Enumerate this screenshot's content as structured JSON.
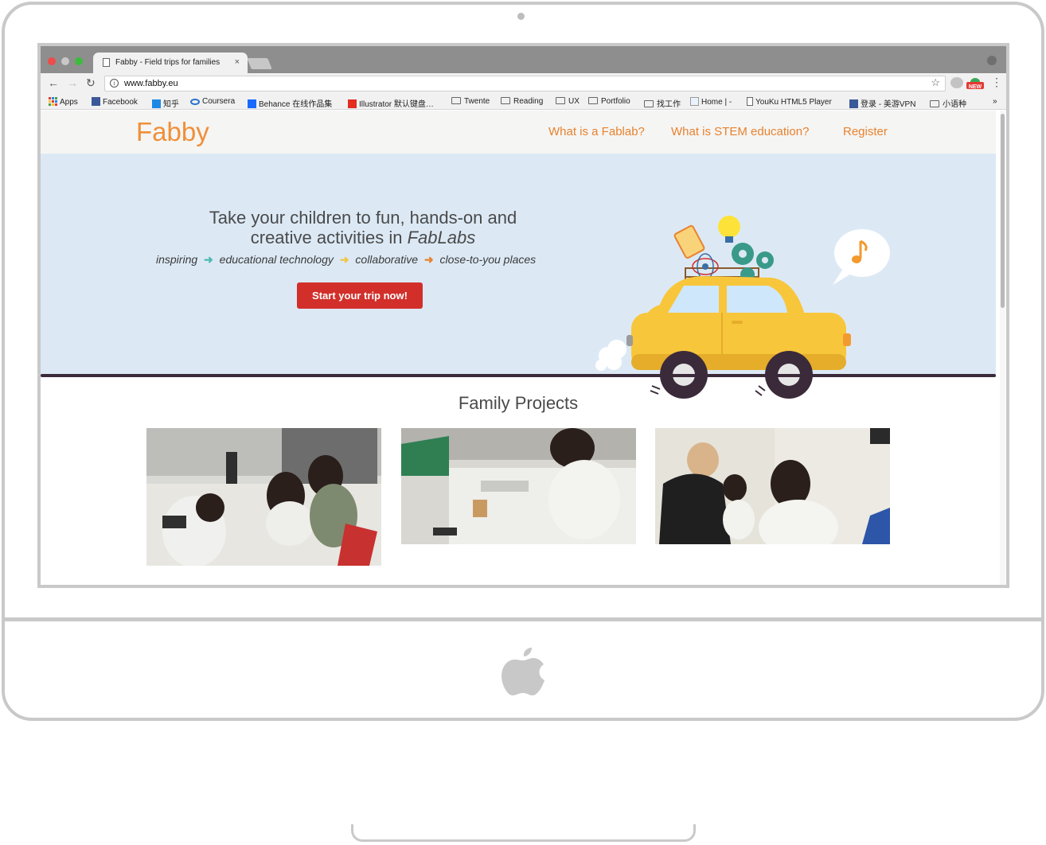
{
  "browser": {
    "tab_title": "Fabby - Field trips for families",
    "tab_close": "×",
    "url": "www.fabby.eu",
    "back": "←",
    "forward": "→",
    "reload": "↻",
    "info": "i",
    "star": "☆",
    "menu": "⋮"
  },
  "bookmarks": [
    {
      "label": "Apps",
      "icon": "apps-grid-icon"
    },
    {
      "label": "Facebook",
      "icon": "facebook-icon"
    },
    {
      "label": "知乎",
      "icon": "zhihu-icon"
    },
    {
      "label": "Coursera",
      "icon": "coursera-icon"
    },
    {
      "label": "Behance 在线作品集",
      "icon": "behance-icon"
    },
    {
      "label": "Illustrator 默认键盘…",
      "icon": "adobe-icon"
    },
    {
      "label": "Twente",
      "icon": "folder-icon"
    },
    {
      "label": "Reading",
      "icon": "folder-icon"
    },
    {
      "label": "UX",
      "icon": "folder-icon"
    },
    {
      "label": "Portfolio",
      "icon": "folder-icon"
    },
    {
      "label": "找工作",
      "icon": "folder-icon"
    },
    {
      "label": "Home | -",
      "icon": "page-icon"
    },
    {
      "label": "YouKu HTML5 Player",
      "icon": "page-icon"
    },
    {
      "label": "登录 - 美游VPN",
      "icon": "facebook-icon"
    },
    {
      "label": "小语种",
      "icon": "folder-icon"
    },
    {
      "label": "»",
      "icon": "overflow-icon"
    }
  ],
  "site": {
    "logo": "Fabby",
    "nav": [
      "What is a Fablab?",
      "What is STEM education?",
      "Register"
    ],
    "headline_line1": "Take your children to fun, hands-on and",
    "headline_line2": "creative activities in ",
    "headline_em": "FabLabs",
    "tagline": [
      "inspiring",
      "educational technology",
      "collaborative",
      "close-to-you places"
    ],
    "tagline_arrow": "➜",
    "cta": "Start your trip now!",
    "projects_title": "Family Projects"
  },
  "colors": {
    "accent_orange": "#e8822f",
    "cta_red": "#d22f2a",
    "hero_bg": "#dce9f5",
    "arrow_teal": "#4fb9b4",
    "arrow_yellow": "#f0c64a",
    "arrow_orange": "#e8822f"
  }
}
